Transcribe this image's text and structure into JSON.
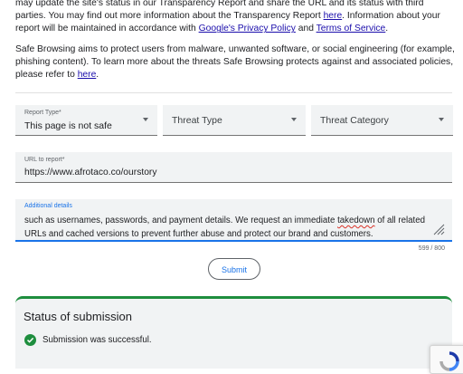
{
  "intro": {
    "p1_a": "may update the site's status in our Transparency Report and share the URL and its status with third parties. You may find out more information about the Transparency Report ",
    "p1_link1": "here",
    "p1_b": ". Information about your report will be maintained in accordance with ",
    "p1_link2": "Google's Privacy Policy",
    "p1_c": " and ",
    "p1_link3": "Terms of Service",
    "p1_d": ".",
    "p2_a": "Safe Browsing aims to protect users from malware, unwanted software, or social engineering (for example, phishing content). To learn more about the threats Safe Browsing protects against and associated policies, please refer to ",
    "p2_link": "here",
    "p2_b": "."
  },
  "form": {
    "report_type_label": "Report Type*",
    "report_type_value": "This page is not safe",
    "threat_type_label": "Threat Type",
    "threat_category_label": "Threat Category",
    "url_label": "URL to report*",
    "url_value": "https://www.afrotaco.co/ourstory",
    "details_label": "Additional details",
    "details_a": "such as usernames, passwords, and payment details. We request an immediate ",
    "details_misspelled": "takedown",
    "details_b": " of all related URLs and cached versions to prevent further abuse and protect our brand and customers.",
    "counter": "599 / 800",
    "submit_label": "Submit"
  },
  "status": {
    "title": "Status of submission",
    "message": "Submission was successful."
  },
  "icons": {
    "dropdown": "chevron-down-icon",
    "success": "check-circle-icon",
    "resize": "resize-handle-icon",
    "recaptcha": "recaptcha-icon"
  },
  "colors": {
    "link": "#1a0dab",
    "accent": "#1a73e8",
    "success": "#1e8e3e",
    "field_bg": "#f1f3f4"
  }
}
